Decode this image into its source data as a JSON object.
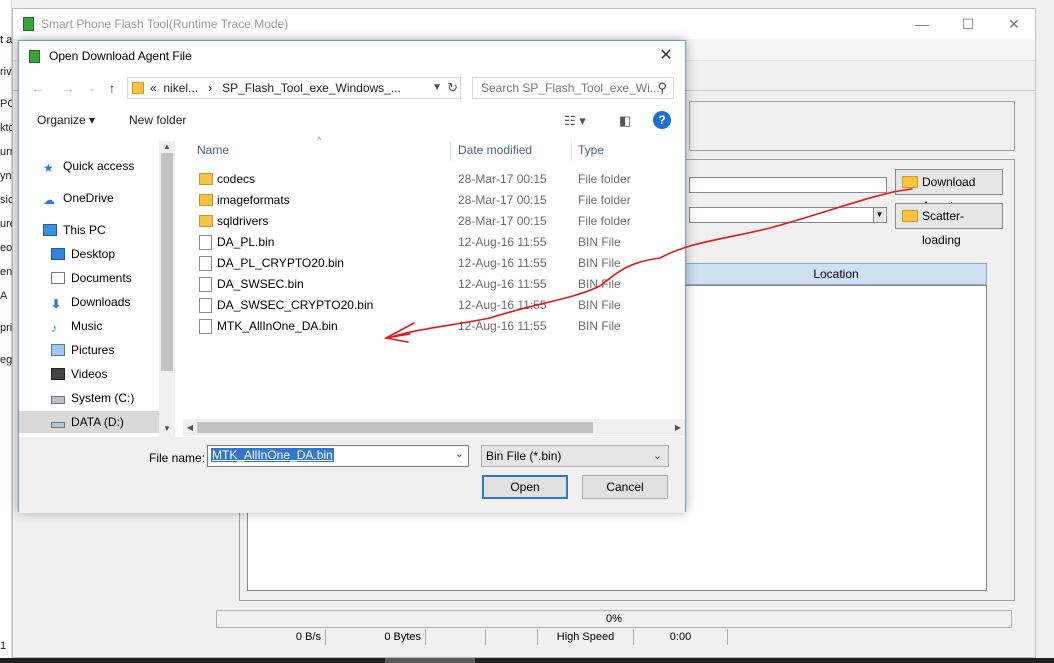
{
  "desktop_strip": [
    "t a",
    "riv",
    "PC",
    "kto",
    "urr",
    "ynl",
    "sic",
    "ure",
    "eos",
    "en",
    "A",
    "pri",
    "eg",
    "1"
  ],
  "main_window": {
    "title": "Smart Phone Flash Tool(Runtime Trace Mode)",
    "minimize": "—",
    "maximize": "☐",
    "close": "✕",
    "download_agent_button": "Download Agent",
    "scatter_loading_button": "Scatter-loading",
    "location_header": "Location",
    "progress_text": "0%",
    "status": {
      "speed": "0 B/s",
      "bytes": "0 Bytes",
      "mode": "High Speed",
      "time": "0:00"
    }
  },
  "dialog": {
    "title": "Open Download Agent File",
    "close": "✕",
    "address": {
      "prefix": "«",
      "crumb1": "nikel...",
      "sep": "›",
      "crumb2": "SP_Flash_Tool_exe_Windows_..."
    },
    "search_placeholder": "Search SP_Flash_Tool_exe_Wi...",
    "toolbar": {
      "organize": "Organize ▾",
      "new_folder": "New folder",
      "help": "?"
    },
    "nav": [
      {
        "label": "Quick access",
        "icon": "star-icon"
      },
      {
        "label": "OneDrive",
        "icon": "cloud-icon"
      },
      {
        "label": "This PC",
        "icon": "computer-icon"
      },
      {
        "label": "Desktop",
        "icon": "desktop-icon"
      },
      {
        "label": "Documents",
        "icon": "documents-icon"
      },
      {
        "label": "Downloads",
        "icon": "download-icon"
      },
      {
        "label": "Music",
        "icon": "music-icon"
      },
      {
        "label": "Pictures",
        "icon": "pictures-icon"
      },
      {
        "label": "Videos",
        "icon": "videos-icon"
      },
      {
        "label": "System (C:)",
        "icon": "drive-icon"
      },
      {
        "label": "DATA (D:)",
        "icon": "drive-icon"
      }
    ],
    "columns": {
      "name": "Name",
      "date": "Date modified",
      "type": "Type"
    },
    "files": [
      {
        "name": "codecs",
        "date": "28-Mar-17 00:15",
        "type": "File folder",
        "kind": "folder"
      },
      {
        "name": "imageformats",
        "date": "28-Mar-17 00:15",
        "type": "File folder",
        "kind": "folder"
      },
      {
        "name": "sqldrivers",
        "date": "28-Mar-17 00:15",
        "type": "File folder",
        "kind": "folder"
      },
      {
        "name": "DA_PL.bin",
        "date": "12-Aug-16 11:55",
        "type": "BIN File",
        "kind": "file"
      },
      {
        "name": "DA_PL_CRYPTO20.bin",
        "date": "12-Aug-16 11:55",
        "type": "BIN File",
        "kind": "file"
      },
      {
        "name": "DA_SWSEC.bin",
        "date": "12-Aug-16 11:55",
        "type": "BIN File",
        "kind": "file"
      },
      {
        "name": "DA_SWSEC_CRYPTO20.bin",
        "date": "12-Aug-16 11:55",
        "type": "BIN File",
        "kind": "file"
      },
      {
        "name": "MTK_AllInOne_DA.bin",
        "date": "12-Aug-16 11:55",
        "type": "BIN File",
        "kind": "file"
      }
    ],
    "file_name_label": "File name:",
    "file_name_value": "MTK_AllInOne_DA.bin",
    "file_type": "Bin File (*.bin)",
    "open_button": "Open",
    "cancel_button": "Cancel"
  },
  "annotation_color": "#e0191b"
}
